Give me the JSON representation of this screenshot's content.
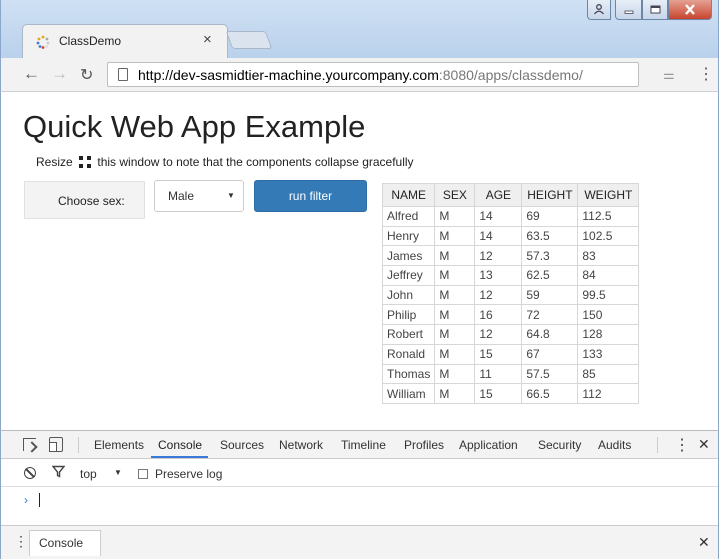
{
  "browser": {
    "tab_title": "ClassDemo",
    "tab_close": "×",
    "url_host": "http://dev-sasmidtier-machine.yourcompany.com",
    "url_rest": ":8080/apps/classdemo/"
  },
  "page": {
    "title": "Quick Web App Example",
    "subtitle_before": "Resize",
    "subtitle_after": "this window to note that the components collapse gracefully",
    "filter_label": "Choose sex:",
    "select_value": "Male",
    "button_label": "run filter"
  },
  "table": {
    "headers": [
      "NAME",
      "SEX",
      "AGE",
      "HEIGHT",
      "WEIGHT"
    ],
    "rows": [
      [
        "Alfred",
        "M",
        "14",
        "69",
        "112.5"
      ],
      [
        "Henry",
        "M",
        "14",
        "63.5",
        "102.5"
      ],
      [
        "James",
        "M",
        "12",
        "57.3",
        "83"
      ],
      [
        "Jeffrey",
        "M",
        "13",
        "62.5",
        "84"
      ],
      [
        "John",
        "M",
        "12",
        "59",
        "99.5"
      ],
      [
        "Philip",
        "M",
        "16",
        "72",
        "150"
      ],
      [
        "Robert",
        "M",
        "12",
        "64.8",
        "128"
      ],
      [
        "Ronald",
        "M",
        "15",
        "67",
        "133"
      ],
      [
        "Thomas",
        "M",
        "11",
        "57.5",
        "85"
      ],
      [
        "William",
        "M",
        "15",
        "66.5",
        "112"
      ]
    ]
  },
  "devtools": {
    "tabs": [
      "Elements",
      "Console",
      "Sources",
      "Network",
      "Timeline",
      "Profiles",
      "Application",
      "Security",
      "Audits"
    ],
    "active_tab": "Console",
    "context": "top",
    "preserve_log": "Preserve log",
    "prompt": "›",
    "drawer_tab": "Console",
    "close": "✕"
  },
  "colors": {
    "accent": "#3879d9",
    "button": "#337ab7"
  }
}
